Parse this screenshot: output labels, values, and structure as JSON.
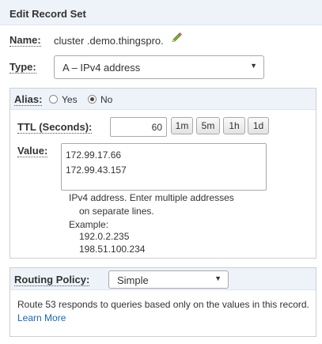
{
  "header": {
    "title": "Edit Record Set"
  },
  "name": {
    "label": "Name:",
    "value": "cluster .demo.thingspro."
  },
  "type": {
    "label": "Type:",
    "selected": "A – IPv4 address"
  },
  "alias": {
    "label": "Alias:",
    "options": [
      "Yes",
      "No"
    ],
    "selected": "No"
  },
  "ttl": {
    "label": "TTL (Seconds):",
    "value": "60",
    "presets": [
      "1m",
      "5m",
      "1h",
      "1d"
    ]
  },
  "value": {
    "label": "Value:",
    "lines": [
      "172.99.17.66",
      "172.99.43.157"
    ],
    "help_line1": "IPv4 address. Enter multiple addresses",
    "help_line2": "on separate lines.",
    "example_label": "Example:",
    "examples": [
      "192.0.2.235",
      "198.51.100.234"
    ]
  },
  "routing": {
    "label": "Routing Policy:",
    "selected": "Simple",
    "description": "Route 53 responds to queries based only on the values in this record.",
    "learn_more": "Learn More"
  },
  "icons": {
    "edit": "pencil-icon",
    "dropdown": "caret-down-icon"
  },
  "colors": {
    "header_bg": "#eef3fa",
    "link": "#1a67b5"
  }
}
